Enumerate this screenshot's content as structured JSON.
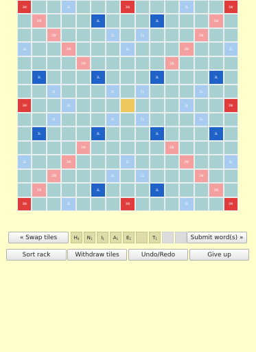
{
  "board": {
    "size": 15,
    "colors": {
      "normal": "#a8d0d0",
      "TW": "#e03c3c",
      "DW": "#f4a0a0",
      "TL": "#1f63c8",
      "DL": "#a8ccf0",
      "center": "#f0c860"
    },
    "labels": {
      "TW": "3W",
      "DW": "2W",
      "TL": "3L",
      "DL": "2L"
    }
  },
  "buttons": {
    "swap": "« Swap tiles",
    "submit": "Submit word(s) »",
    "sort": "Sort rack",
    "withdraw": "Withdraw tiles",
    "undo": "Undo/Redo",
    "giveup": "Give up"
  },
  "rack": [
    {
      "letter": "H",
      "score": "4"
    },
    {
      "letter": "N",
      "score": "1"
    },
    {
      "letter": "I",
      "score": "1"
    },
    {
      "letter": "A",
      "score": "1"
    },
    {
      "letter": "E",
      "score": "1"
    },
    {
      "letter": "",
      "score": ""
    },
    {
      "letter": "T",
      "score": "1"
    }
  ]
}
